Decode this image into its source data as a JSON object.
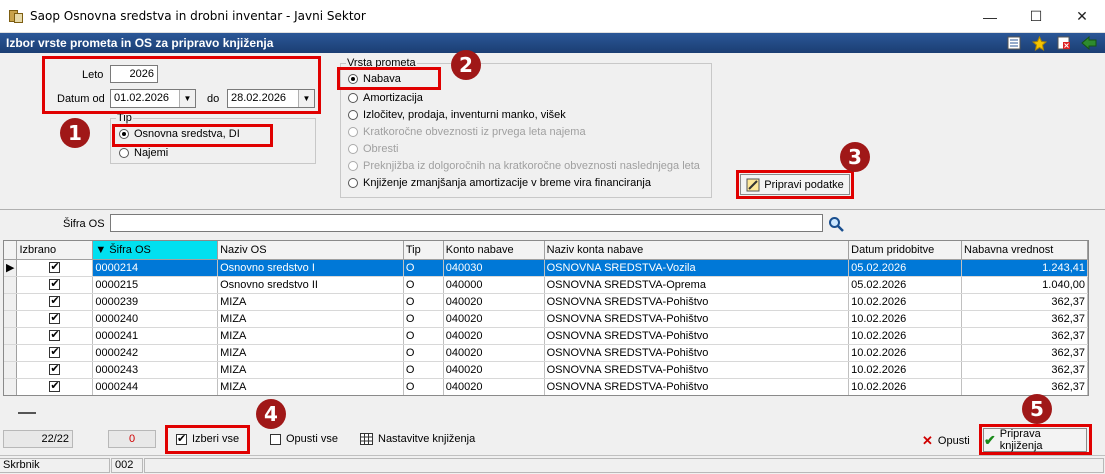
{
  "window": {
    "title": "Saop Osnovna sredstva in drobni inventar - Javni Sektor",
    "controls": {
      "minimize": "—",
      "maximize": "☐",
      "close": "✕"
    }
  },
  "header": {
    "title": "Izbor vrste prometa in OS za pripravo knjiženja",
    "icons": [
      "notes-icon",
      "star-icon",
      "close-doc-icon",
      "exit-icon"
    ]
  },
  "params": {
    "leto_label": "Leto",
    "leto_value": "2026",
    "datum_od_label": "Datum od",
    "datum_od_value": "01.02.2026",
    "do_label": "do",
    "datum_do_value": "28.02.2026"
  },
  "tip": {
    "title": "Tip",
    "options": [
      {
        "label": "Osnovna sredstva, DI",
        "selected": true
      },
      {
        "label": "Najemi",
        "selected": false
      }
    ]
  },
  "vrsta_prometa": {
    "title": "Vrsta prometa",
    "options": [
      {
        "label": "Nabava",
        "selected": true,
        "disabled": false
      },
      {
        "label": "Amortizacija",
        "selected": false,
        "disabled": false
      },
      {
        "label": "Izločitev, prodaja, inventurni manko, višek",
        "selected": false,
        "disabled": false
      },
      {
        "label": "Kratkoročne obveznosti iz prvega leta najema",
        "selected": false,
        "disabled": true
      },
      {
        "label": "Obresti",
        "selected": false,
        "disabled": true
      },
      {
        "label": "Preknjižba iz dolgoročnih na kratkoročne obveznosti naslednjega leta",
        "selected": false,
        "disabled": true
      },
      {
        "label": "Knjiženje zmanjšanja amortizacije v breme vira financiranja",
        "selected": false,
        "disabled": false
      }
    ]
  },
  "pripravi_button": "Pripravi podatke",
  "filter": {
    "label": "Šifra OS",
    "value": ""
  },
  "callouts": [
    "1",
    "2",
    "3",
    "4",
    "5"
  ],
  "table": {
    "columns": [
      "Izbrano",
      "Šifra OS",
      "Naziv OS",
      "Tip",
      "Konto nabave",
      "Naziv konta nabave",
      "Datum pridobitve",
      "Nabavna vrednost"
    ],
    "sort_arrow": "▼",
    "rows": [
      {
        "sifra": "0000214",
        "naziv": "Osnovno sredstvo I",
        "tip": "O",
        "konto": "040030",
        "naziv_konta": "OSNOVNA SREDSTVA-Vozila",
        "datum": "05.02.2026",
        "vrednost": "1.243,41",
        "checked": true
      },
      {
        "sifra": "0000215",
        "naziv": "Osnovno sredstvo II",
        "tip": "O",
        "konto": "040000",
        "naziv_konta": "OSNOVNA SREDSTVA-Oprema",
        "datum": "05.02.2026",
        "vrednost": "1.040,00",
        "checked": true
      },
      {
        "sifra": "0000239",
        "naziv": "MIZA",
        "tip": "O",
        "konto": "040020",
        "naziv_konta": "OSNOVNA SREDSTVA-Pohištvo",
        "datum": "10.02.2026",
        "vrednost": "362,37",
        "checked": true
      },
      {
        "sifra": "0000240",
        "naziv": "MIZA",
        "tip": "O",
        "konto": "040020",
        "naziv_konta": "OSNOVNA SREDSTVA-Pohištvo",
        "datum": "10.02.2026",
        "vrednost": "362,37",
        "checked": true
      },
      {
        "sifra": "0000241",
        "naziv": "MIZA",
        "tip": "O",
        "konto": "040020",
        "naziv_konta": "OSNOVNA SREDSTVA-Pohištvo",
        "datum": "10.02.2026",
        "vrednost": "362,37",
        "checked": true
      },
      {
        "sifra": "0000242",
        "naziv": "MIZA",
        "tip": "O",
        "konto": "040020",
        "naziv_konta": "OSNOVNA SREDSTVA-Pohištvo",
        "datum": "10.02.2026",
        "vrednost": "362,37",
        "checked": true
      },
      {
        "sifra": "0000243",
        "naziv": "MIZA",
        "tip": "O",
        "konto": "040020",
        "naziv_konta": "OSNOVNA SREDSTVA-Pohištvo",
        "datum": "10.02.2026",
        "vrednost": "362,37",
        "checked": true
      },
      {
        "sifra": "0000244",
        "naziv": "MIZA",
        "tip": "O",
        "konto": "040020",
        "naziv_konta": "OSNOVNA SREDSTVA-Pohištvo",
        "datum": "10.02.2026",
        "vrednost": "362,37",
        "checked": true
      }
    ]
  },
  "footer": {
    "count": "22/22",
    "zero": "0",
    "izberi_vse": "Izberi vse",
    "opusti_vse": "Opusti vse",
    "nastavitve": "Nastavitve knjiženja",
    "opusti": "Opusti",
    "priprava": "Priprava knjiženja"
  },
  "status": {
    "user": "Skrbnik",
    "code": "002"
  },
  "colors": {
    "header_bg": "#1b3e73",
    "selection": "#0078d7",
    "sorted_header": "#00e0f0",
    "callout": "#a01818",
    "highlight_box": "#e00000"
  }
}
